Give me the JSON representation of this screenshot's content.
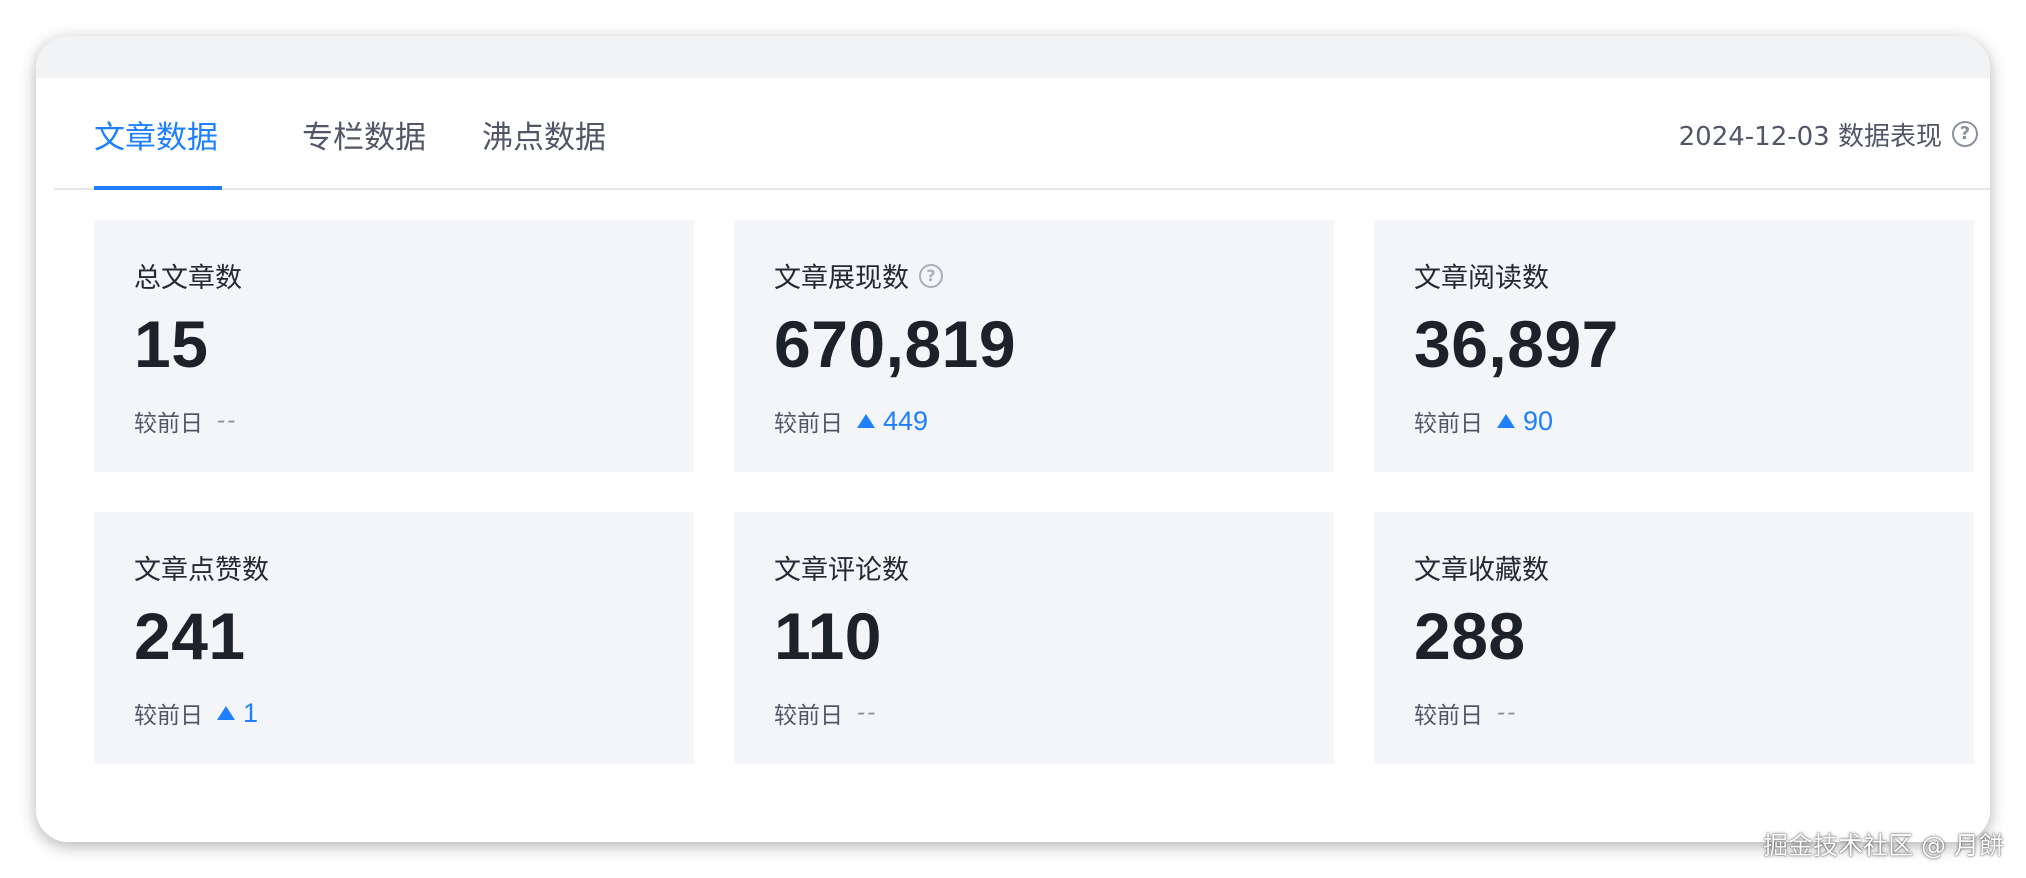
{
  "tabs": [
    {
      "label": "文章数据",
      "active": true
    },
    {
      "label": "专栏数据",
      "active": false
    },
    {
      "label": "沸点数据",
      "active": false
    }
  ],
  "date_label": "2024-12-03 数据表现",
  "compare_label": "较前日",
  "cards": [
    {
      "title": "总文章数",
      "value": "15",
      "compare": "--",
      "trend": "flat"
    },
    {
      "title": "文章展现数",
      "value": "670,819",
      "compare": "449",
      "trend": "up",
      "has_help": true
    },
    {
      "title": "文章阅读数",
      "value": "36,897",
      "compare": "90",
      "trend": "up"
    },
    {
      "title": "文章点赞数",
      "value": "241",
      "compare": "1",
      "trend": "up"
    },
    {
      "title": "文章评论数",
      "value": "110",
      "compare": "--",
      "trend": "flat"
    },
    {
      "title": "文章收藏数",
      "value": "288",
      "compare": "--",
      "trend": "flat"
    }
  ],
  "colors": {
    "accent": "#1e80ff",
    "card_bg": "#f4f5f8",
    "text_primary": "#1d2129",
    "text_secondary": "#515767"
  },
  "icons": {
    "help": "question-circle-icon",
    "up": "triangle-up-icon"
  },
  "watermark": "掘金技术社区 @ 月餅"
}
